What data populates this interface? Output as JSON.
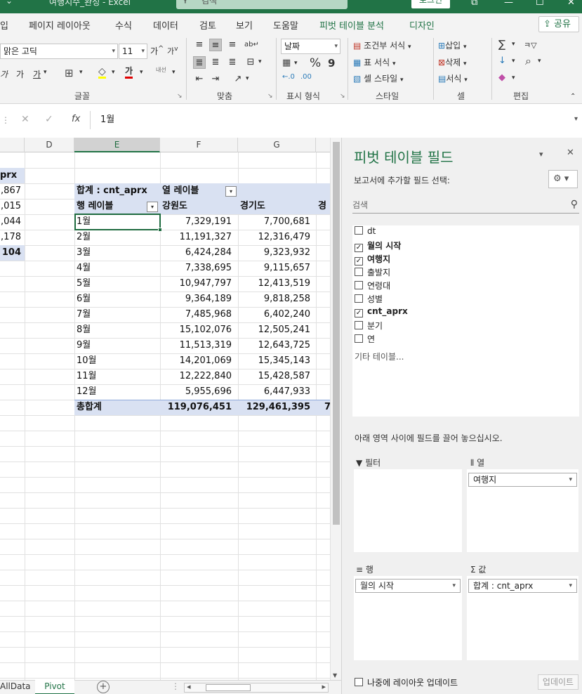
{
  "window": {
    "qat_glyph": "⌄",
    "doc_title": "여행지수_완성  -  Excel",
    "search_placeholder": "검색",
    "signin_label": "로그인",
    "btn_restore_glyph": "⧉",
    "btn_min_glyph": "—",
    "btn_max_glyph": "☐",
    "btn_close_glyph": "✕"
  },
  "ribbon_tabs": [
    "입",
    "페이지 레이아웃",
    "수식",
    "데이터",
    "검토",
    "보기",
    "도움말",
    "피벗 테이블 분석",
    "디자인"
  ],
  "share_label": "공유",
  "ribbon": {
    "font_name": "맑은 고딕",
    "font_size": "11",
    "grow_font": "가",
    "shrink_font": "가",
    "italic": "가",
    "strike": "가",
    "underline": "가",
    "border_glyph": "⊞",
    "fill_glyph": "◇",
    "font_color": "가",
    "phonetic": "내선",
    "group_font": "글꼴",
    "group_align": "맞춤",
    "number_format": "날짜",
    "percent": "%",
    "comma": "9",
    "inc_dec": "←.0",
    "dec_dec": ".00",
    "group_number": "표시 형식",
    "cond_format": "조건부 서식",
    "table_format": "표 서식",
    "cell_style": "셀 스타일",
    "group_style": "스타일",
    "insert": "삽입",
    "delete": "삭제",
    "format": "서식",
    "group_cells": "셀",
    "sum_glyph": "∑",
    "sort_glyph": "ㅋ▽",
    "fill_down_glyph": "↓",
    "find_glyph": "⌕",
    "clear_glyph": "◆",
    "group_edit": "편집",
    "launcher_glyph": "↘"
  },
  "formula_bar": {
    "colon": "⋮",
    "cancel_glyph": "✕",
    "enter_glyph": "✓",
    "fx": "fx",
    "value": "1월"
  },
  "columns": {
    "C": "",
    "D": "D",
    "E": "E",
    "F": "F",
    "G": "G"
  },
  "left_partial": {
    "header": "prx",
    "values": [
      ",867",
      ",015",
      ",044",
      ",178"
    ],
    "total": "104"
  },
  "pivot": {
    "value_label": "합계 : cnt_aprx",
    "column_labels": "열 레이블",
    "row_labels": "행 레이블",
    "filter_glyph": "▾",
    "column_headers": [
      "강원도",
      "경기도",
      "경"
    ],
    "rows": [
      {
        "label": "1월",
        "v1": "7,329,191",
        "v2": "7,700,681"
      },
      {
        "label": "2월",
        "v1": "11,191,327",
        "v2": "12,316,479"
      },
      {
        "label": "3월",
        "v1": "6,424,284",
        "v2": "9,323,932"
      },
      {
        "label": "4월",
        "v1": "7,338,695",
        "v2": "9,115,657"
      },
      {
        "label": "5월",
        "v1": "10,947,797",
        "v2": "12,413,519"
      },
      {
        "label": "6월",
        "v1": "9,364,189",
        "v2": "9,818,258"
      },
      {
        "label": "7월",
        "v1": "7,485,968",
        "v2": "6,402,240"
      },
      {
        "label": "8월",
        "v1": "15,102,076",
        "v2": "12,505,241"
      },
      {
        "label": "9월",
        "v1": "11,513,319",
        "v2": "12,643,725"
      },
      {
        "label": "10월",
        "v1": "14,201,069",
        "v2": "15,345,143"
      },
      {
        "label": "11월",
        "v1": "12,222,840",
        "v2": "15,428,587"
      },
      {
        "label": "12월",
        "v1": "5,955,696",
        "v2": "6,447,933"
      }
    ],
    "total_label": "총합계",
    "total_v1": "119,076,451",
    "total_v2": "129,461,395",
    "total_v3": "7"
  },
  "sheet_tabs": {
    "left": "AllData",
    "active": "Pivot",
    "add_glyph": "+",
    "dots": "⋮",
    "left_arrow": "◂",
    "right_arrow": "▸"
  },
  "field_pane": {
    "title": "피벗 테이블 필드",
    "dropdown_glyph": "▾",
    "close_glyph": "✕",
    "subtitle": "보고서에 추가할 필드 선택:",
    "gear_glyph": "⚙ ▾",
    "search_placeholder": "검색",
    "fields": [
      {
        "name": "dt",
        "mark": ""
      },
      {
        "name": "월의 시작",
        "mark": "✓"
      },
      {
        "name": "여행지",
        "mark": "✓"
      },
      {
        "name": "출발지",
        "mark": ""
      },
      {
        "name": "연령대",
        "mark": ""
      },
      {
        "name": "성별",
        "mark": ""
      },
      {
        "name": "cnt_aprx",
        "mark": "✓"
      },
      {
        "name": "분기",
        "mark": ""
      },
      {
        "name": "연",
        "mark": ""
      }
    ],
    "other_tables": "기타 테이블...",
    "drag_hint": "아래 영역 사이에 필드를 끌어 놓으십시오.",
    "area_filter": "필터",
    "area_columns": "열",
    "area_rows": "행",
    "area_values": "값",
    "area_columns_item": "여행지",
    "area_rows_item": "월의 시작",
    "area_values_item": "합계 : cnt_aprx",
    "defer_label": "나중에 레이아웃 업데이트",
    "update_label": "업데이트"
  },
  "colors": {
    "excel_green": "#217346",
    "pivot_header": "#d9e1f2",
    "active_cell": "#1e6b3f"
  }
}
